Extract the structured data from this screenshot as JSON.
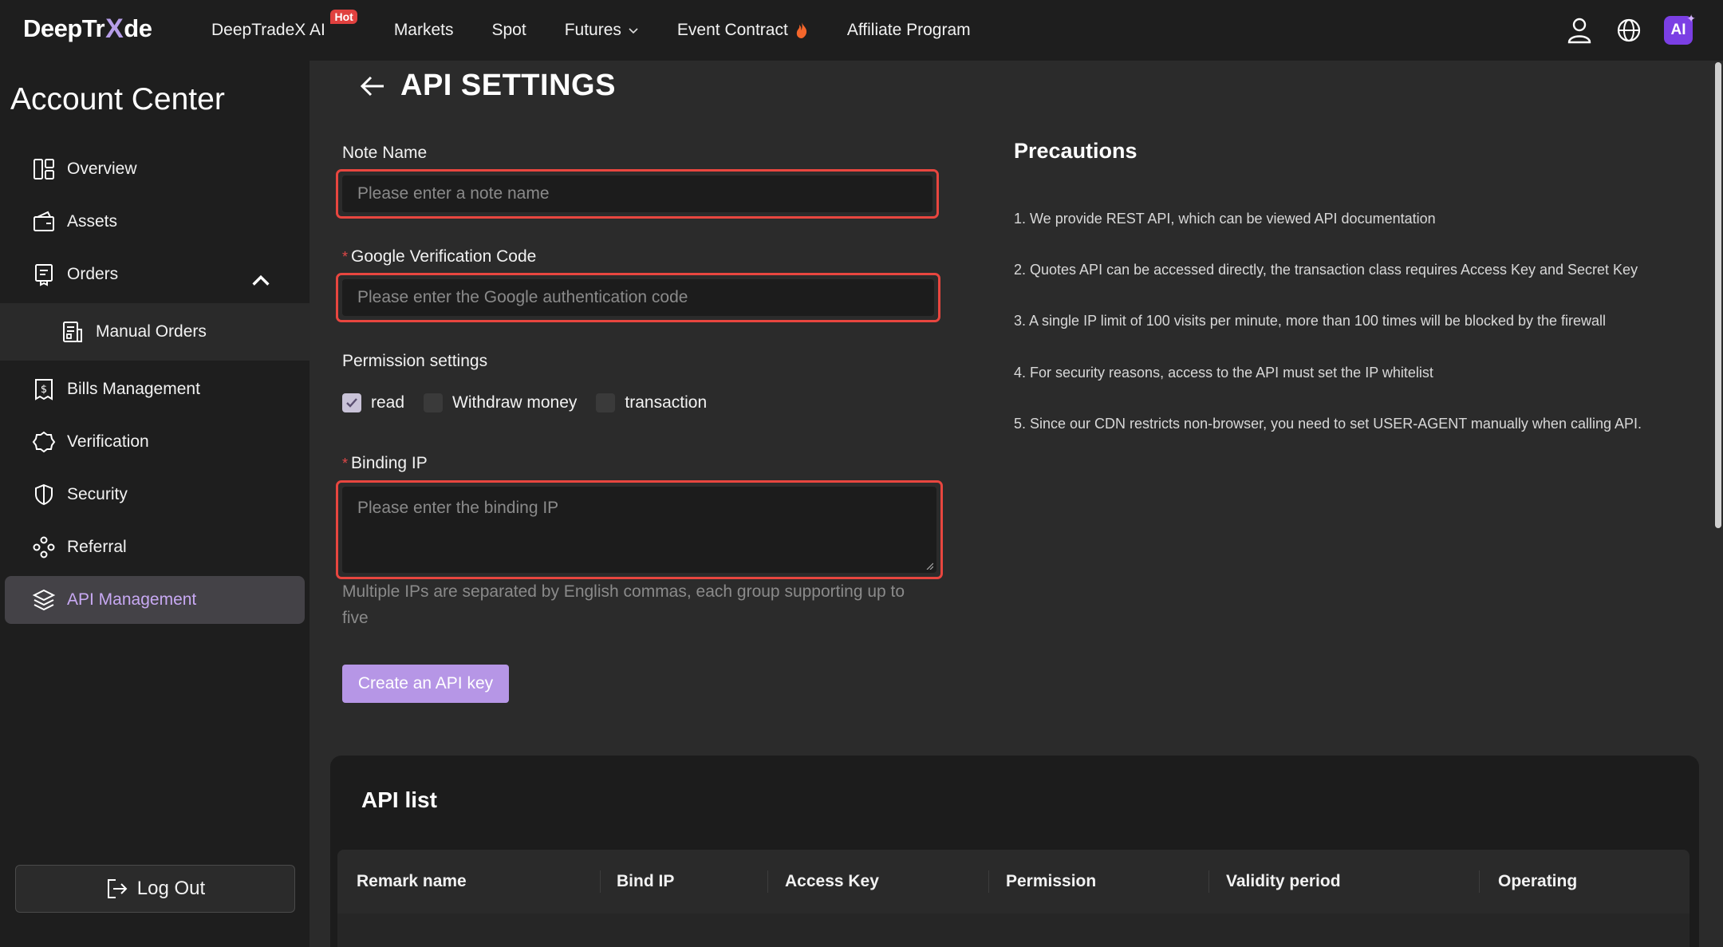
{
  "brand": {
    "logo_left": "DeepTr",
    "logo_mark": "X",
    "logo_right": "de"
  },
  "nav": {
    "ai_label": "DeepTradeX AI",
    "hot_badge": "Hot",
    "markets": "Markets",
    "spot": "Spot",
    "futures": "Futures",
    "event_contract": "Event Contract",
    "affiliate": "Affiliate Program",
    "ai_chip": "AI"
  },
  "sidebar": {
    "title": "Account Center",
    "items": {
      "overview": "Overview",
      "assets": "Assets",
      "orders": "Orders",
      "manual_orders": "Manual Orders",
      "bills": "Bills Management",
      "verification": "Verification",
      "security": "Security",
      "referral": "Referral",
      "api": "API Management"
    },
    "logout": "Log Out"
  },
  "page": {
    "title": "API SETTINGS"
  },
  "form": {
    "note_name": {
      "label": "Note Name",
      "placeholder": "Please enter a note name"
    },
    "google_code": {
      "required": "*",
      "label": "Google Verification Code",
      "placeholder": "Please enter the Google authentication code"
    },
    "permissions": {
      "label": "Permission settings",
      "options": [
        {
          "label": "read",
          "checked": true
        },
        {
          "label": "Withdraw money",
          "checked": false
        },
        {
          "label": "transaction",
          "checked": false
        }
      ]
    },
    "binding_ip": {
      "required": "*",
      "label": "Binding IP",
      "placeholder": "Please enter the binding IP",
      "hint": "Multiple IPs are separated by English commas, each group supporting up to five"
    },
    "submit": "Create an API key"
  },
  "precautions": {
    "title": "Precautions",
    "items": [
      "1. We provide REST API, which can be viewed API documentation",
      "2. Quotes API can be accessed directly, the transaction class requires Access Key and Secret Key",
      "3. A single IP limit of 100 visits per minute, more than 100 times will be blocked by the firewall",
      "4. For security reasons, access to the API must set the IP whitelist",
      "5. Since our CDN restricts non-browser, you need to set USER-AGENT manually when calling API."
    ]
  },
  "api_list": {
    "title": "API list",
    "columns": [
      "Remark name",
      "Bind IP",
      "Access Key",
      "Permission",
      "Validity period",
      "Operating"
    ]
  },
  "colors": {
    "accent": "#b696e6",
    "active_text": "#c8a9f3",
    "highlight_border": "#e8463f",
    "hot": "#e0413f",
    "ai_chip": "#7b3fe4"
  }
}
